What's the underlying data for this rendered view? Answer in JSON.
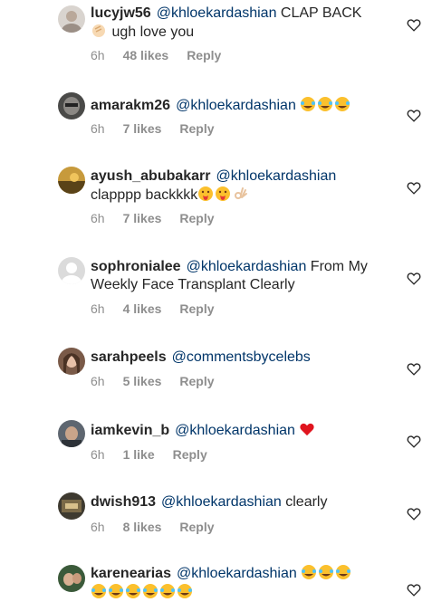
{
  "comments": [
    {
      "username": "lucyjw56",
      "mention": "@khloekardashian",
      "text": "CLAP BACK",
      "line2_text": "ugh love you",
      "emojis_inline": [
        "clapping-hands"
      ],
      "time": "6h",
      "likes": "48 likes",
      "reply": "Reply"
    },
    {
      "username": "amarakm26",
      "mention": "@khloekardashian",
      "text": "",
      "emojis_inline": [
        "tears-of-joy",
        "tears-of-joy",
        "tears-of-joy"
      ],
      "time": "6h",
      "likes": "7 likes",
      "reply": "Reply"
    },
    {
      "username": "ayush_abubakarr",
      "mention": "@khloekardashian",
      "text": "",
      "line2_text": "clapppp backkkk",
      "emojis_inline": [
        "tongue-out-face",
        "tongue-out-face",
        "ok-hand"
      ],
      "time": "6h",
      "likes": "7 likes",
      "reply": "Reply"
    },
    {
      "username": "sophronialee",
      "mention": "@khloekardashian",
      "text": "From My",
      "line2_text": "Weekly Face Transplant Clearly",
      "time": "6h",
      "likes": "4 likes",
      "reply": "Reply"
    },
    {
      "username": "sarahpeels",
      "mention": "@commentsbycelebs",
      "text": "",
      "time": "6h",
      "likes": "5 likes",
      "reply": "Reply"
    },
    {
      "username": "iamkevin_b",
      "mention": "@khloekardashian",
      "text": "",
      "emojis_inline": [
        "red-heart"
      ],
      "time": "6h",
      "likes": "1 like",
      "reply": "Reply"
    },
    {
      "username": "dwish913",
      "mention": "@khloekardashian",
      "text": "clearly",
      "time": "6h",
      "likes": "8 likes",
      "reply": "Reply"
    },
    {
      "username": "karenearias",
      "mention": "@khloekardashian",
      "text": "",
      "emojis_inline": [
        "tears-of-joy",
        "tears-of-joy",
        "tears-of-joy"
      ],
      "emojis_line2": [
        "tears-of-joy",
        "tears-of-joy",
        "tears-of-joy",
        "tears-of-joy",
        "tears-of-joy",
        "tears-of-joy"
      ]
    }
  ],
  "colors": {
    "text": "#262626",
    "mention": "#003569",
    "meta": "#8e8e8e",
    "heart_outline": "#262626"
  },
  "icons": {
    "like": "heart-outline-icon"
  }
}
